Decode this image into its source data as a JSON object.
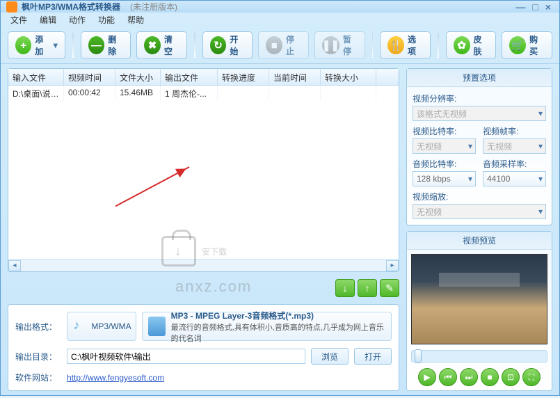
{
  "title": {
    "main": "枫叶MP3/WMA格式转换器",
    "sub": "(未注册版本)"
  },
  "menu": {
    "file": "文件",
    "edit": "编辑",
    "action": "动作",
    "func": "功能",
    "help": "帮助"
  },
  "toolbar": {
    "add": "添加",
    "del": "删除",
    "clear": "清空",
    "start": "开始",
    "stop": "停止",
    "pause": "暂停",
    "options": "选项",
    "skin": "皮肤",
    "buy": "购买"
  },
  "grid": {
    "headers": {
      "c1": "输入文件",
      "c2": "视频时间",
      "c3": "文件大小",
      "c4": "输出文件",
      "c5": "转换进度",
      "c6": "当前时间",
      "c7": "转换大小"
    },
    "row": {
      "c1": "D:\\桌面\\说明...",
      "c2": "00:00:42",
      "c3": "15.46MB",
      "c4": "1 周杰伦-...",
      "c5": "",
      "c6": "",
      "c7": ""
    }
  },
  "out": {
    "fmt_lbl": "输出格式：",
    "fmt_name": "MP3/WMA",
    "fmt_title": "MP3 - MPEG Layer-3音频格式(*.mp3)",
    "fmt_desc": "最流行的音频格式,具有体积小,音质高的特点,几乎成为网上音乐的代名词",
    "dir_lbl": "输出目录：",
    "dir_val": "C:\\枫叶视频软件\\输出",
    "browse": "浏览",
    "open": "打开",
    "site_lbl": "软件网站：",
    "site_url": "http://www.fengyesoft.com"
  },
  "preset": {
    "title": "预置选项",
    "vres_lbl": "视频分辨率:",
    "vres_val": "该格式无视频",
    "vbit_lbl": "视频比特率:",
    "vbit_val": "无视频",
    "vfps_lbl": "视频帧率:",
    "vfps_val": "无视频",
    "abit_lbl": "音频比特率:",
    "abit_val": "128 kbps",
    "arate_lbl": "音频采样率:",
    "arate_val": "44100",
    "vzoom_lbl": "视频缩放:",
    "vzoom_val": "无视频"
  },
  "preview": {
    "title": "视频预览"
  },
  "watermark": {
    "text": "安下载",
    "domain": "anxz.com"
  }
}
